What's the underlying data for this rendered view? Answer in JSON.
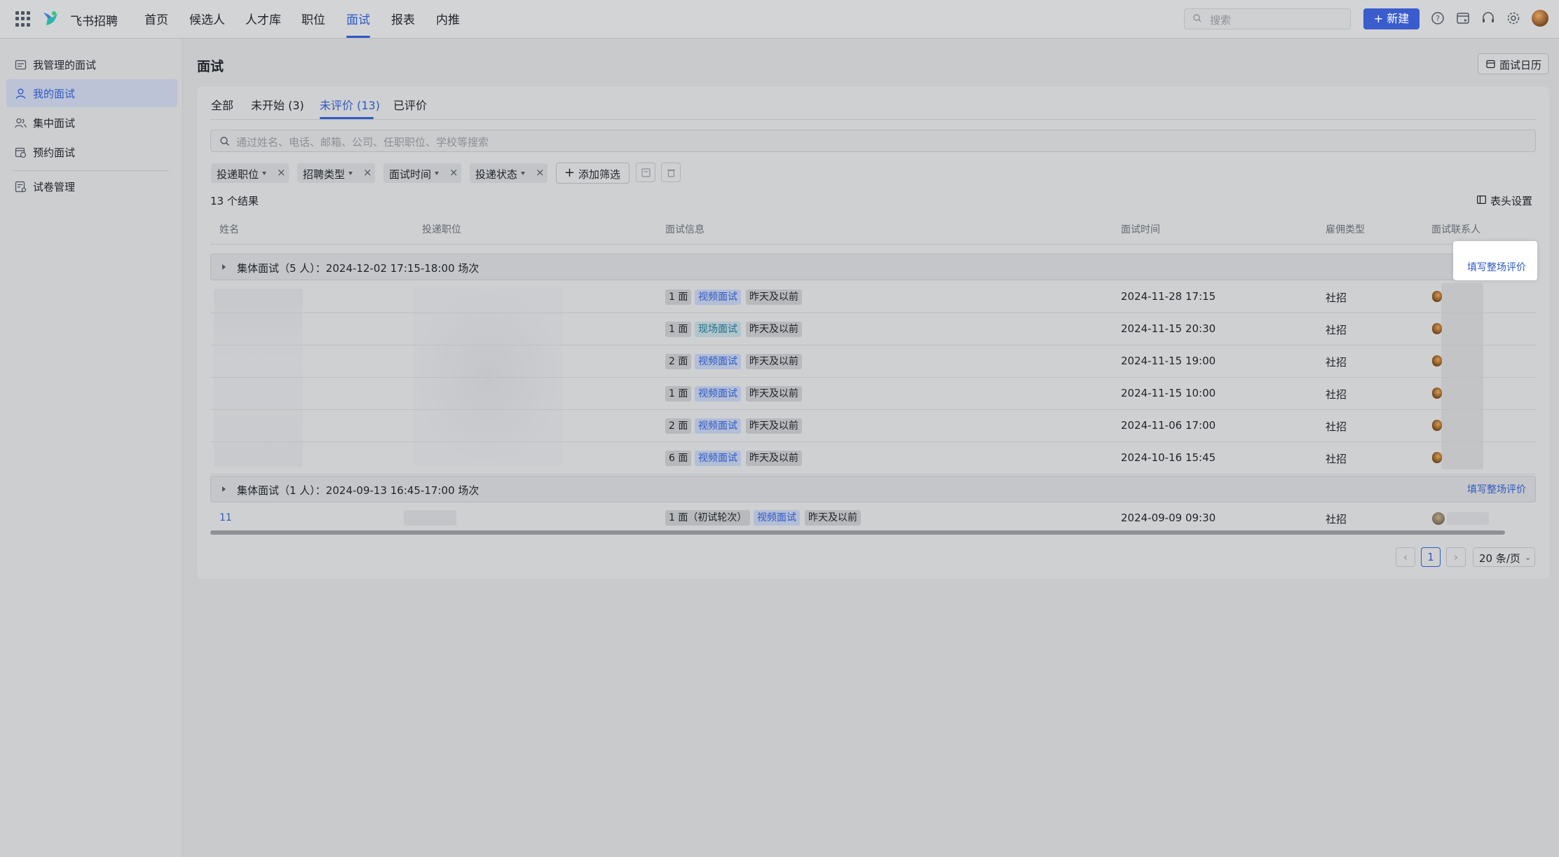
{
  "app": {
    "name": "飞书招聘"
  },
  "nav": {
    "items": [
      "首页",
      "候选人",
      "人才库",
      "职位",
      "面试",
      "报表",
      "内推"
    ],
    "active": "面试"
  },
  "top": {
    "search_placeholder": "搜索",
    "new_button": "+ 新建"
  },
  "sidebar": {
    "items": [
      {
        "label": "我管理的面试",
        "icon": "calendar-list-icon"
      },
      {
        "label": "我的面试",
        "icon": "user-icon",
        "active": true
      },
      {
        "label": "集中面试",
        "icon": "group-icon"
      },
      {
        "label": "预约面试",
        "icon": "calendar-clock-icon"
      }
    ],
    "extra": {
      "label": "试卷管理",
      "icon": "exam-icon"
    }
  },
  "main": {
    "title": "面试",
    "calendar_button": "面试日历",
    "tabs": [
      "全部",
      "未开始 (3)",
      "未评价 (13)",
      "已评价"
    ],
    "active_tab": "未评价 (13)",
    "search_placeholder": "通过姓名、电话、邮箱、公司、任职职位、学校等搜索",
    "filters": [
      "投递职位",
      "招聘类型",
      "面试时间",
      "投递状态"
    ],
    "add_filter": "添加筛选",
    "result_count": "13 个结果",
    "column_settings": "表头设置",
    "columns": [
      "姓名",
      "投递职位",
      "面试信息",
      "面试时间",
      "雇佣类型",
      "面试联系人"
    ],
    "groups": [
      {
        "title": "集体面试（5 人）：2024-12-02 17:15-18:00 场次",
        "action": "填写整场评价",
        "rows": [
          {
            "round": "1 面",
            "mode": "视频面试",
            "status": "昨天及以前",
            "time": "2024-11-28 17:15",
            "type": "社招"
          },
          {
            "round": "1 面",
            "mode": "现场面试",
            "status": "昨天及以前",
            "time": "2024-11-15 20:30",
            "type": "社招"
          },
          {
            "round": "2 面",
            "mode": "视频面试",
            "status": "昨天及以前",
            "time": "2024-11-15 19:00",
            "type": "社招"
          },
          {
            "round": "1 面",
            "mode": "视频面试",
            "status": "昨天及以前",
            "time": "2024-11-15 10:00",
            "type": "社招"
          },
          {
            "round": "2 面",
            "mode": "视频面试",
            "status": "昨天及以前",
            "time": "2024-11-06 17:00",
            "type": "社招"
          },
          {
            "round": "6 面",
            "mode": "视频面试",
            "status": "昨天及以前",
            "time": "2024-10-16 15:45",
            "type": "社招"
          }
        ]
      },
      {
        "title": "集体面试（1 人）：2024-09-13 16:45-17:00 场次",
        "action": "填写整场评价",
        "rows": [
          {
            "name": "11",
            "round": "1 面（初试轮次）",
            "mode": "视频面试",
            "status": "昨天及以前",
            "time": "2024-09-09 09:30",
            "type": "社招"
          }
        ]
      }
    ],
    "pagination": {
      "current": "1",
      "page_size": "20 条/页"
    }
  },
  "colors": {
    "accent": "#2f59c4",
    "primary_button": "#3a5ccc"
  }
}
